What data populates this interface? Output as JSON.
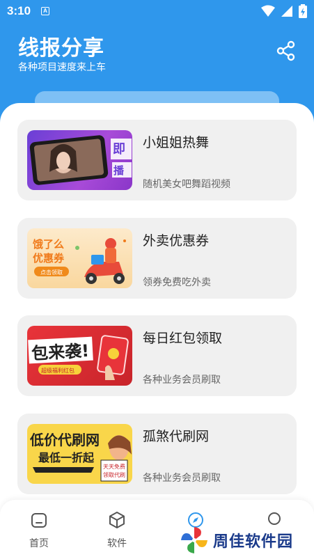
{
  "status_bar": {
    "time": "3:10",
    "notification_glyph": "A"
  },
  "header": {
    "title": "线报分享",
    "subtitle": "各种项目速度来上车",
    "share_icon": "share-icon"
  },
  "cards": [
    {
      "title": "小姐姐热舞",
      "desc": "随机美女吧舞蹈视频",
      "thumb_text": "即\n播"
    },
    {
      "title": "外卖优惠券",
      "desc": "领券免费吃外卖",
      "thumb_text": "饿了么\n优惠券",
      "thumb_btn": "点击领取"
    },
    {
      "title": "每日红包领取",
      "desc": "各种业务会员刷取",
      "thumb_text": "包来袭!",
      "thumb_btn": "超级福利红包"
    },
    {
      "title": "孤煞代刷网",
      "desc": "各种业务会员刷取",
      "thumb_text": "低价代刷网\n最低一折起",
      "thumb_side": "天天免费\n领取代刷"
    }
  ],
  "bottom_nav": [
    {
      "label": "首页",
      "icon": "home-icon"
    },
    {
      "label": "软件",
      "icon": "cube-icon"
    },
    {
      "label": "",
      "icon": "compass-icon",
      "active_color": "#2f97ec"
    },
    {
      "label": "",
      "icon": "circle-icon"
    }
  ],
  "watermark": {
    "text": "周佳软件园"
  },
  "colors": {
    "primary": "#2f97ec",
    "card_bg": "#f0f0f0"
  }
}
